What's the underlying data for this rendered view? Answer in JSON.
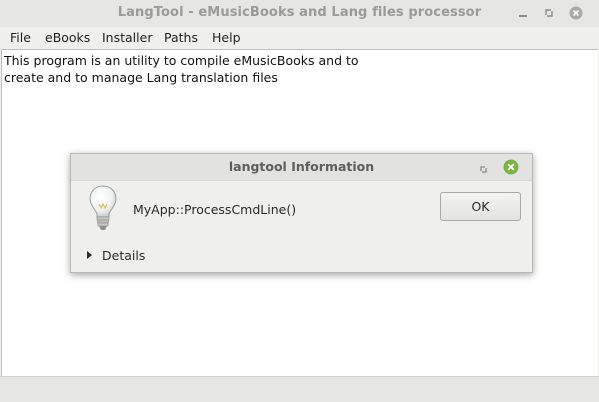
{
  "window": {
    "title": "LangTool - eMusicBooks and Lang files processor",
    "controls": [
      "minimize-icon",
      "restore-icon",
      "close-icon"
    ]
  },
  "menu": {
    "items": [
      "File",
      "eBooks",
      "Installer",
      "Paths",
      "Help"
    ]
  },
  "content": {
    "text": "This program is an utility to compile eMusicBooks and to\ncreate and to manage Lang translation files"
  },
  "dialog": {
    "title": "langtool Information",
    "message": "MyApp::ProcessCmdLine()",
    "ok_label": "OK",
    "details_label": "Details",
    "icon": "lightbulb-icon"
  },
  "colors": {
    "close_green": "#7cb342",
    "background": "#efefee",
    "titlebar": "#e6e6e5"
  }
}
